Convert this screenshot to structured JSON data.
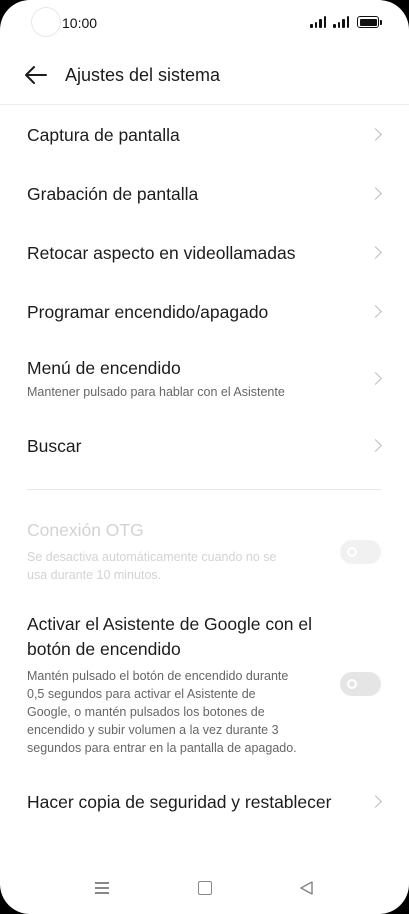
{
  "status_bar": {
    "time": "10:00",
    "icons": [
      "signal-icon",
      "signal-icon",
      "battery-icon"
    ]
  },
  "header": {
    "back_icon": "arrow-left-icon",
    "title": "Ajustes del sistema"
  },
  "items": [
    {
      "title": "Captura de pantalla",
      "icon": "chevron-right-icon"
    },
    {
      "title": "Grabación de pantalla",
      "icon": "chevron-right-icon"
    },
    {
      "title": "Retocar aspecto en videollamadas",
      "icon": "chevron-right-icon"
    },
    {
      "title": "Programar encendido/apagado",
      "icon": "chevron-right-icon"
    },
    {
      "title": "Menú de encendido",
      "subtitle": "Mantener pulsado para hablar con el Asistente",
      "icon": "chevron-right-icon"
    },
    {
      "title": "Buscar",
      "icon": "chevron-right-icon"
    }
  ],
  "toggles": [
    {
      "title": "Conexión OTG",
      "subtitle_lines": [
        "Se desactiva automáticamente cuando no se",
        "usa durante 10 minutos."
      ],
      "state": "off",
      "enabled": false
    },
    {
      "title_lines": [
        "Activar el Asistente de Google con el",
        "botón de encendido"
      ],
      "subtitle_lines": [
        "Mantén pulsado el botón de encendido durante",
        "0,5 segundos para activar el Asistente de",
        "Google, o mantén pulsados los botones de",
        "encendido y subir volumen a la vez durante 3",
        "segundos para entrar en la pantalla de apagado."
      ],
      "state": "off",
      "enabled": true
    }
  ],
  "last_item": {
    "title": "Hacer copia de seguridad y restablecer",
    "icon": "chevron-right-icon"
  },
  "nav_bar": {
    "icons": [
      "menu-icon",
      "home-icon",
      "back-triangle-icon"
    ]
  }
}
